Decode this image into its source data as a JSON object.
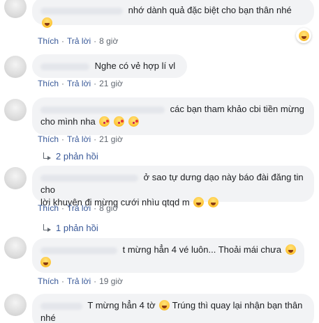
{
  "comments": [
    {
      "text": "nhớ dành quả đặc biệt cho bạn thân nhé",
      "like": "Thích",
      "reply": "Trả lời",
      "time": "8 giờ"
    },
    {
      "text": "Nghe có vẻ hợp lí vl",
      "like": "Thích",
      "reply": "Trả lời",
      "time": "21 giờ"
    },
    {
      "text": "các bạn tham khảo cbi tiền mừng",
      "text2": "cho mình nha",
      "like": "Thích",
      "reply": "Trả lời",
      "time": "21 giờ",
      "replies": "2 phản hồi"
    },
    {
      "text": "ở sao tự dưng dạo này báo đài đăng tin cho",
      "text2": "lời khuyên đi mừng cưới nhìu qtqd m",
      "like": "Thích",
      "reply": "Trả lời",
      "time": "8 giờ",
      "replies": "1 phản hồi"
    },
    {
      "text": "t mừng hẳn 4 vé luôn... Thoải mái chưa",
      "like": "Thích",
      "reply": "Trả lời",
      "time": "19 giờ"
    },
    {
      "text": "T mừng hẳn 4 tờ",
      "text_b": "Trúng thì quay lại nhận bạn thân nhé"
    }
  ],
  "icons": {
    "laugh": "laughing-emoji-icon",
    "kiss": "kissing-heart-emoji-icon",
    "smile": "grinning-emoji-icon"
  },
  "colors": {
    "link": "#385898",
    "bubble": "#f2f3f5",
    "meta": "#606770"
  }
}
